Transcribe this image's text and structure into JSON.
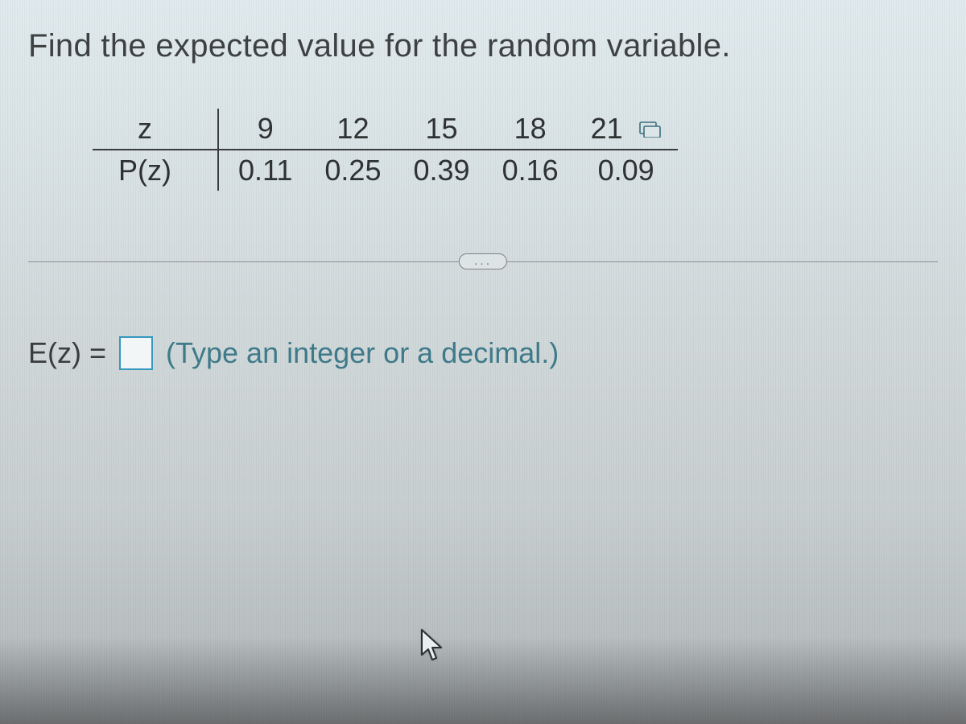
{
  "question": "Find the expected value for the random variable.",
  "table": {
    "row1_label": "z",
    "row2_label": "P(z)",
    "columns": [
      {
        "z": "9",
        "p": "0.11"
      },
      {
        "z": "12",
        "p": "0.25"
      },
      {
        "z": "15",
        "p": "0.39"
      },
      {
        "z": "18",
        "p": "0.16"
      },
      {
        "z": "21",
        "p": "0.09"
      }
    ]
  },
  "divider_label": "...",
  "answer": {
    "prefix": "E(z) =",
    "value": "",
    "hint": "(Type an integer or a decimal.)"
  },
  "chart_data": {
    "type": "table",
    "title": "Discrete probability distribution of z",
    "columns": [
      "z",
      "P(z)"
    ],
    "rows": [
      [
        9,
        0.11
      ],
      [
        12,
        0.25
      ],
      [
        15,
        0.39
      ],
      [
        18,
        0.16
      ],
      [
        21,
        0.09
      ]
    ]
  }
}
